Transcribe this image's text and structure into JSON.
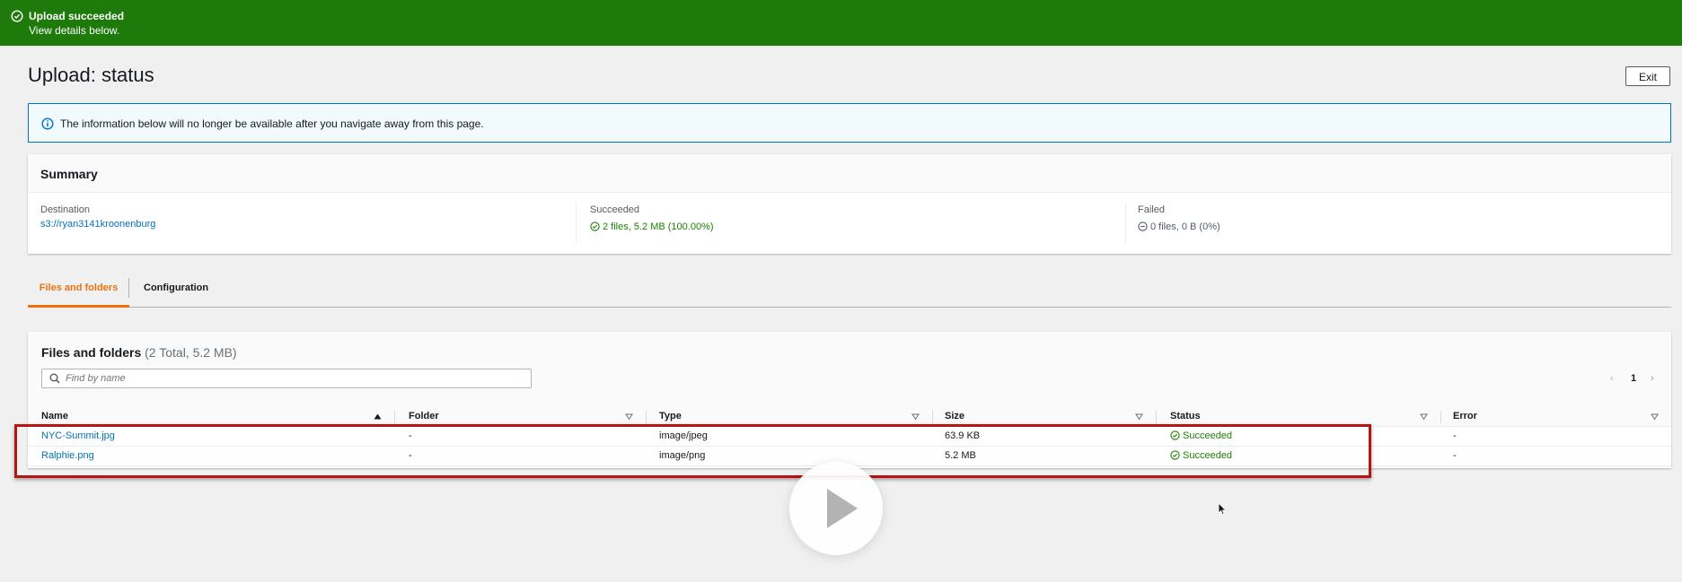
{
  "flash": {
    "title": "Upload succeeded",
    "subtitle": "View details below.",
    "color": "#1d7a0b"
  },
  "page": {
    "title": "Upload: status",
    "exit_label": "Exit"
  },
  "info": {
    "message": "The information below will no longer be available after you navigate away from this page."
  },
  "summary": {
    "title": "Summary",
    "destination": {
      "label": "Destination",
      "value": "s3://ryan3141kroonenburg"
    },
    "succeeded": {
      "label": "Succeeded",
      "value": "2 files, 5.2 MB (100.00%)"
    },
    "failed": {
      "label": "Failed",
      "value": "0 files, 0 B (0%)"
    }
  },
  "tabs": [
    {
      "label": "Files and folders",
      "active": true
    },
    {
      "label": "Configuration",
      "active": false
    }
  ],
  "files": {
    "title": "Files and folders",
    "count": "(2 Total, 5.2 MB)",
    "search_placeholder": "Find by name",
    "page": "1",
    "prev": "‹",
    "next": "›",
    "columns": [
      "Name",
      "Folder",
      "Type",
      "Size",
      "Status",
      "Error"
    ],
    "rows": [
      {
        "name": "NYC-Summit.jpg",
        "folder": "-",
        "type": "image/jpeg",
        "size": "63.9 KB",
        "status": "Succeeded",
        "error": "-"
      },
      {
        "name": "Ralphie.png",
        "folder": "-",
        "type": "image/png",
        "size": "5.2 MB",
        "status": "Succeeded",
        "error": "-"
      }
    ]
  },
  "colors": {
    "link": "#0073bb",
    "success": "#1d8102",
    "tab_active": "#ec7211",
    "highlight_border": "#b41412"
  },
  "icons": {
    "flash": "check-circle-icon",
    "info": "info-circle-icon",
    "succeeded": "check-circle-icon",
    "failed": "minus-circle-icon",
    "search": "search-icon",
    "sort": "sort-caret-icon",
    "video": "play-icon",
    "pointer": "mouse-cursor-icon"
  }
}
